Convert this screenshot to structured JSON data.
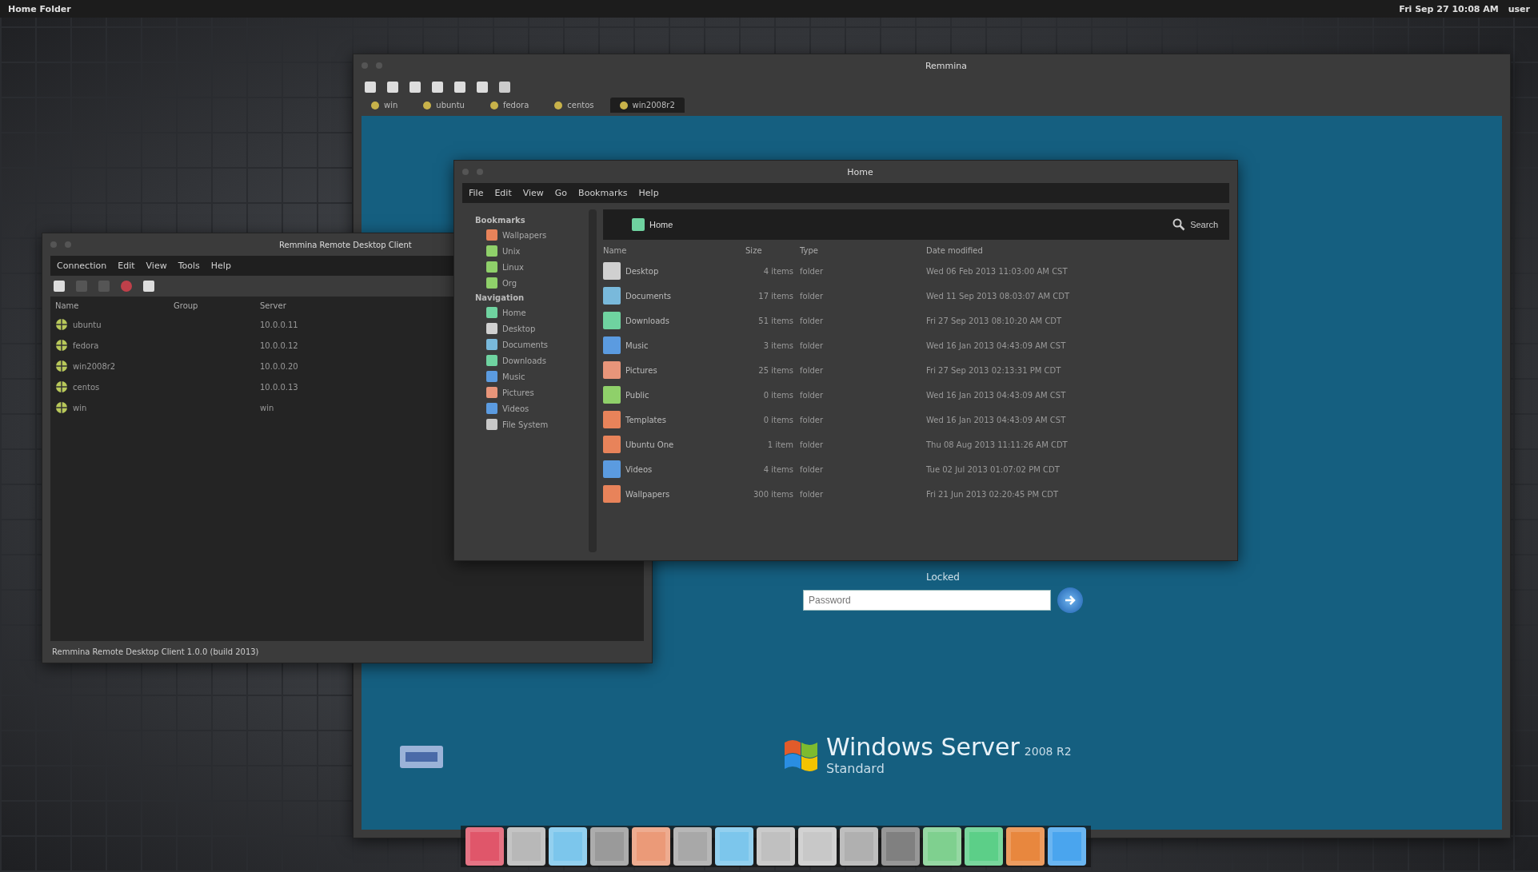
{
  "top_bar": {
    "title": "Home Folder",
    "clock": "Fri Sep 27 10:08 AM",
    "user": "user"
  },
  "remote_window": {
    "title": "Remmina",
    "tabs": [
      {
        "label": "win",
        "selected": false
      },
      {
        "label": "ubuntu",
        "selected": false
      },
      {
        "label": "fedora",
        "selected": false
      },
      {
        "label": "centos",
        "selected": false
      },
      {
        "label": "win2008r2",
        "selected": true
      }
    ]
  },
  "lock_screen": {
    "status": "Locked",
    "password": {
      "placeholder": "Password"
    },
    "brand": "Windows Server",
    "version": "2008 R2",
    "edition": "Standard"
  },
  "remmina": {
    "title": "Remmina Remote Desktop Client",
    "menu": [
      "Connection",
      "Edit",
      "View",
      "Tools",
      "Help"
    ],
    "columns": [
      "Name",
      "Group",
      "Server"
    ],
    "rows": [
      {
        "name": "ubuntu",
        "server": "10.0.0.11"
      },
      {
        "name": "fedora",
        "server": "10.0.0.12"
      },
      {
        "name": "win2008r2",
        "server": "10.0.0.20"
      },
      {
        "name": "centos",
        "server": "10.0.0.13"
      },
      {
        "name": "win",
        "server": "win"
      }
    ],
    "status": "Remmina Remote Desktop Client 1.0.0 (build 2013)"
  },
  "file_manager": {
    "title": "Home",
    "menu": [
      "File",
      "Edit",
      "View",
      "Go",
      "Bookmarks",
      "Help"
    ],
    "sidebar": [
      {
        "heading": "Bookmarks",
        "items": [
          {
            "label": "Wallpapers",
            "color": "#e8835a"
          },
          {
            "label": "Unix",
            "color": "#8fd06a"
          },
          {
            "label": "Linux",
            "color": "#8fd06a"
          },
          {
            "label": "Org",
            "color": "#8fd06a"
          }
        ]
      },
      {
        "heading": "Navigation",
        "items": [
          {
            "label": "Home",
            "color": "#6fd3a0"
          },
          {
            "label": "Desktop",
            "color": "#d0d0d0"
          },
          {
            "label": "Documents",
            "color": "#79b9db"
          },
          {
            "label": "Downloads",
            "color": "#6fd3a0"
          },
          {
            "label": "Music",
            "color": "#5b9be0"
          },
          {
            "label": "Pictures",
            "color": "#e8957a"
          },
          {
            "label": "Videos",
            "color": "#5b9be0"
          },
          {
            "label": "File System",
            "color": "#c8c8c8"
          }
        ]
      }
    ],
    "path": "Home",
    "search": "Search",
    "columns": [
      "Name",
      "Size",
      "Type",
      "Date modified"
    ],
    "rows": [
      {
        "name": "Desktop",
        "size": "4 items",
        "type": "folder",
        "modified": "Wed 06 Feb 2013 11:03:00 AM CST",
        "color": "#d0d0d0"
      },
      {
        "name": "Documents",
        "size": "17 items",
        "type": "folder",
        "modified": "Wed 11 Sep 2013 08:03:07 AM CDT",
        "color": "#79b9db"
      },
      {
        "name": "Downloads",
        "size": "51 items",
        "type": "folder",
        "modified": "Fri 27 Sep 2013 08:10:20 AM CDT",
        "color": "#6fd3a0"
      },
      {
        "name": "Music",
        "size": "3 items",
        "type": "folder",
        "modified": "Wed 16 Jan 2013 04:43:09 AM CST",
        "color": "#5b9be0"
      },
      {
        "name": "Pictures",
        "size": "25 items",
        "type": "folder",
        "modified": "Fri 27 Sep 2013 02:13:31 PM CDT",
        "color": "#e8957a"
      },
      {
        "name": "Public",
        "size": "0 items",
        "type": "folder",
        "modified": "Wed 16 Jan 2013 04:43:09 AM CST",
        "color": "#8fd06a"
      },
      {
        "name": "Templates",
        "size": "0 items",
        "type": "folder",
        "modified": "Wed 16 Jan 2013 04:43:09 AM CST",
        "color": "#e8835a"
      },
      {
        "name": "Ubuntu One",
        "size": "1 item",
        "type": "folder",
        "modified": "Thu 08 Aug 2013 11:11:26 AM CDT",
        "color": "#e8835a"
      },
      {
        "name": "Videos",
        "size": "4 items",
        "type": "folder",
        "modified": "Tue 02 Jul 2013 01:07:02 PM CDT",
        "color": "#5b9be0"
      },
      {
        "name": "Wallpapers",
        "size": "300 items",
        "type": "folder",
        "modified": "Fri 21 Jun 2013 02:20:45 PM CDT",
        "color": "#e8835a"
      }
    ]
  },
  "dock": [
    {
      "color": "#e0566a"
    },
    {
      "color": "#b8b8b8"
    },
    {
      "color": "#7cc6ec"
    },
    {
      "color": "#9a9a9a"
    },
    {
      "color": "#eb9a78"
    },
    {
      "color": "#a8a8a8"
    },
    {
      "color": "#7cc6ec"
    },
    {
      "color": "#c0c0c0"
    },
    {
      "color": "#c8c8c8"
    },
    {
      "color": "#b0b0b0"
    },
    {
      "color": "#808080"
    },
    {
      "color": "#7fd08f"
    },
    {
      "color": "#5ccf88"
    },
    {
      "color": "#e8873e"
    },
    {
      "color": "#4aa5ee"
    }
  ]
}
